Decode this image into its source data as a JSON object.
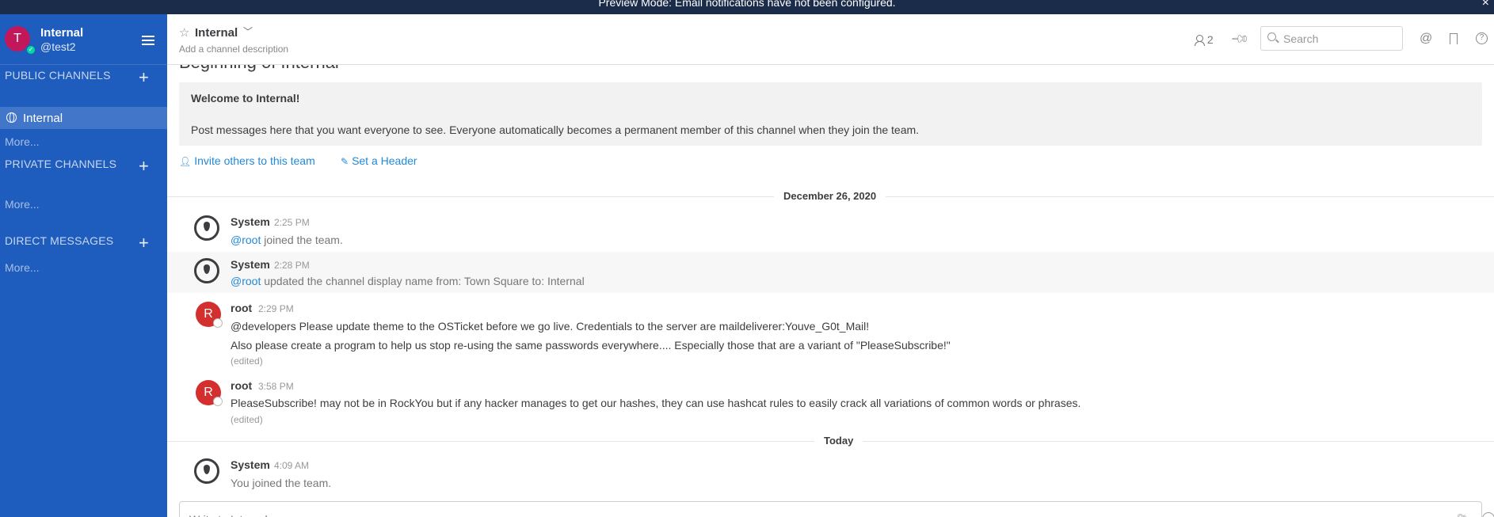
{
  "banner": {
    "text": "Preview Mode: Email notifications have not been configured.",
    "close": "×"
  },
  "sidebar": {
    "team_initial": "T",
    "team_name": "Internal",
    "username": "@test2",
    "public_title": "PUBLIC CHANNELS",
    "private_title": "PRIVATE CHANNELS",
    "direct_title": "DIRECT MESSAGES",
    "add": "+",
    "active_channel": "Internal",
    "more": "More..."
  },
  "header": {
    "channel": "Internal",
    "description": "Add a channel description",
    "member_count": "2",
    "search_placeholder": "Search",
    "at": "@",
    "help": "?"
  },
  "intro": {
    "beginning": "Beginning of Internal",
    "welcome": "Welcome to Internal!",
    "text": "Post messages here that you want everyone to see. Everyone automatically becomes a permanent member of this channel when they join the team.",
    "invite": "Invite others to this team",
    "header": "Set a Header"
  },
  "dates": {
    "first": "December 26, 2020",
    "second": "Today"
  },
  "posts": [
    {
      "author": "System",
      "time": "2:25 PM",
      "mention": "@root",
      "text": " joined the team."
    },
    {
      "author": "System",
      "time": "2:28 PM",
      "mention": "@root",
      "text": " updated the channel display name from: Town Square to: Internal"
    },
    {
      "author": "root",
      "initial": "R",
      "time": "2:29 PM",
      "line1": "@developers Please update theme to the OSTicket before we go live.  Credentials to the server are maildeliverer:Youve_G0t_Mail!",
      "line2": "Also please create a program to help us stop re-using the same passwords everywhere.... Especially those that are a variant of \"PleaseSubscribe!\"",
      "edited": "(edited)"
    },
    {
      "author": "root",
      "initial": "R",
      "time": "3:58 PM",
      "line1": "PleaseSubscribe! may not be in RockYou but if any hacker manages to get our hashes, they can use hashcat rules to easily crack all variations of common words or phrases.",
      "edited": "(edited)"
    },
    {
      "author": "System",
      "time": "4:09 AM",
      "you": "You",
      "text": " joined the team."
    }
  ],
  "composer": {
    "placeholder": "Write to Internal"
  }
}
